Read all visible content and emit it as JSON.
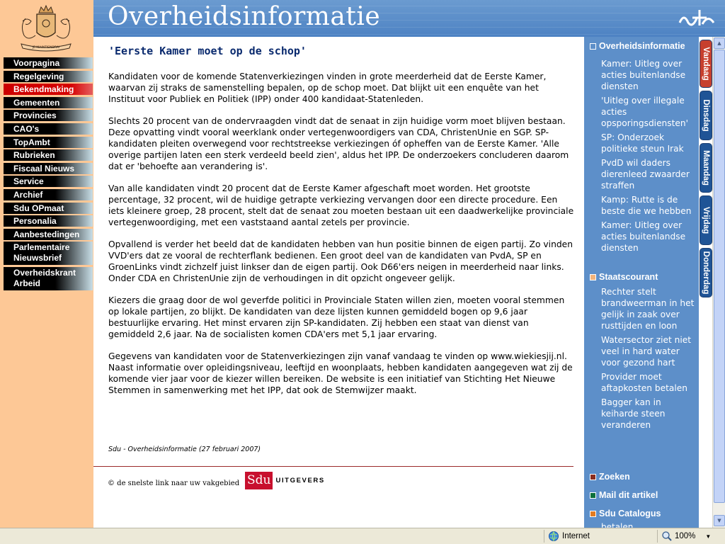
{
  "site": {
    "title": "Overheidsinformatie"
  },
  "nav": [
    "Voorpagina",
    "Regelgeving",
    "Bekendmaking",
    "Gemeenten",
    "Provincies",
    "CAO's",
    "TopAmbt",
    "Rubrieken",
    "Fiscaal Nieuws",
    "Service",
    "Archief",
    "Sdu OPmaat",
    "Personalia",
    "Aanbestedingen",
    "Parlementaire Nieuwsbrief",
    "Overheidskrant Arbeid"
  ],
  "article": {
    "title": "'Eerste Kamer moet op de schop'",
    "paragraphs": [
      "Kandidaten voor de komende Statenverkiezingen vinden in grote meerderheid dat de Eerste Kamer, waarvan zij straks de samenstelling bepalen, op de schop moet. Dat blijkt uit een enquête van het Instituut voor Publiek en Politiek (IPP) onder 400 kandidaat-Statenleden.",
      "Slechts 20 procent van de ondervraagden vindt dat de senaat in zijn huidige vorm moet blijven bestaan. Deze opvatting vindt vooral weerklank onder vertegenwoordigers van CDA, ChristenUnie en SGP. SP-kandidaten pleiten overwegend voor rechtstreekse verkiezingen óf opheffen van de Eerste Kamer. 'Alle overige partijen laten een sterk verdeeld beeld zien', aldus het IPP. De onderzoekers concluderen daarom dat er 'behoefte aan verandering is'.",
      "Van alle kandidaten vindt 20 procent dat de Eerste Kamer afgeschaft moet worden. Het grootste percentage, 32 procent, wil de huidige getrapte verkiezing vervangen door een directe procedure. Een iets kleinere groep, 28 procent, stelt dat de senaat zou moeten bestaan uit een daadwerkelijke provinciale vertegenwoordiging, met een vaststaand aantal zetels per provincie.",
      "Opvallend is verder het beeld dat de kandidaten hebben van hun positie binnen de eigen partij. Zo vinden VVD'ers dat ze vooral de rechterflank bedienen. Een groot deel van de kandidaten van PvdA, SP en GroenLinks vindt zichzelf juist linkser dan de eigen partij. Ook D66'ers neigen in meerderheid naar links. Onder CDA en ChristenUnie zijn de verhoudingen in dit opzicht ongeveer gelijk.",
      "Kiezers die graag door de wol geverfde politici in Provinciale Staten willen zien, moeten vooral stemmen op lokale partijen, zo blijkt. De kandidaten van deze lijsten kunnen gemiddeld bogen op 9,6 jaar bestuurlijke ervaring. Het minst ervaren zijn SP-kandidaten. Zij hebben een staat van dienst van gemiddeld 2,6 jaar. Na de socialisten komen CDA'ers met 5,1 jaar ervaring.",
      "Gegevens van kandidaten voor de Statenverkiezingen zijn vanaf vandaag te vinden op www.wiekiesjij.nl. Naast informatie over opleidingsniveau, leeftijd en woonplaats, hebben kandidaten aangegeven wat zij de komende vier jaar voor de kiezer willen bereiken. De website is een initiatief van Stichting Het Nieuwe Stemmen in samenwerking met het IPP, dat ook de Stemwijzer maakt."
    ],
    "source": "Sdu - Overheidsinformatie  (27 februari 2007)"
  },
  "footer": {
    "copyright": "© de snelste link naar uw vakgebied",
    "logo_box": "Sdu",
    "logo_text": "UITGEVERS"
  },
  "sidebar": {
    "section1": {
      "title": "Overheidsinformatie",
      "links": [
        "Kamer: Uitleg over acties buitenlandse diensten",
        "'Uitleg over illegale acties opsporingsdiensten'",
        "SP: Onderzoek politieke steun Irak",
        "PvdD wil daders dierenleed zwaarder straffen",
        "Kamp: Rutte is de beste die we hebben",
        "Kamer: Uitleg over acties buitenlandse diensten"
      ]
    },
    "section2": {
      "title": "Staatscourant",
      "links": [
        "Rechter stelt brandweerman in het gelijk in zaak over rusttijden en loon",
        "Watersector ziet niet veel in hard water voor gezond hart",
        "Provider moet aftapkosten betalen",
        "Bagger kan in keiharde steen veranderen"
      ]
    },
    "zoeken": "Zoeken",
    "mail": "Mail dit artikel",
    "catalogus": "Sdu Catalogus",
    "catalogus_sub": "betalen"
  },
  "tabs": [
    "Vandaag",
    "Dinsdag",
    "Maandag",
    "Vrijdag",
    "Donderdag"
  ],
  "status": {
    "zone": "Internet",
    "zoom": "100%"
  },
  "colors": {
    "left_bg": "#fdc896",
    "header_blue": "#5d8fc9",
    "active_nav": "#cc0000",
    "tab_red": "#c7402e",
    "tab_blue": "#1f5496",
    "sq_staatscourant": "#f2b37a",
    "sq_zoeken": "#8b2e1f",
    "sq_mail": "#0b6f3c",
    "sq_catalogus": "#e27b20"
  }
}
